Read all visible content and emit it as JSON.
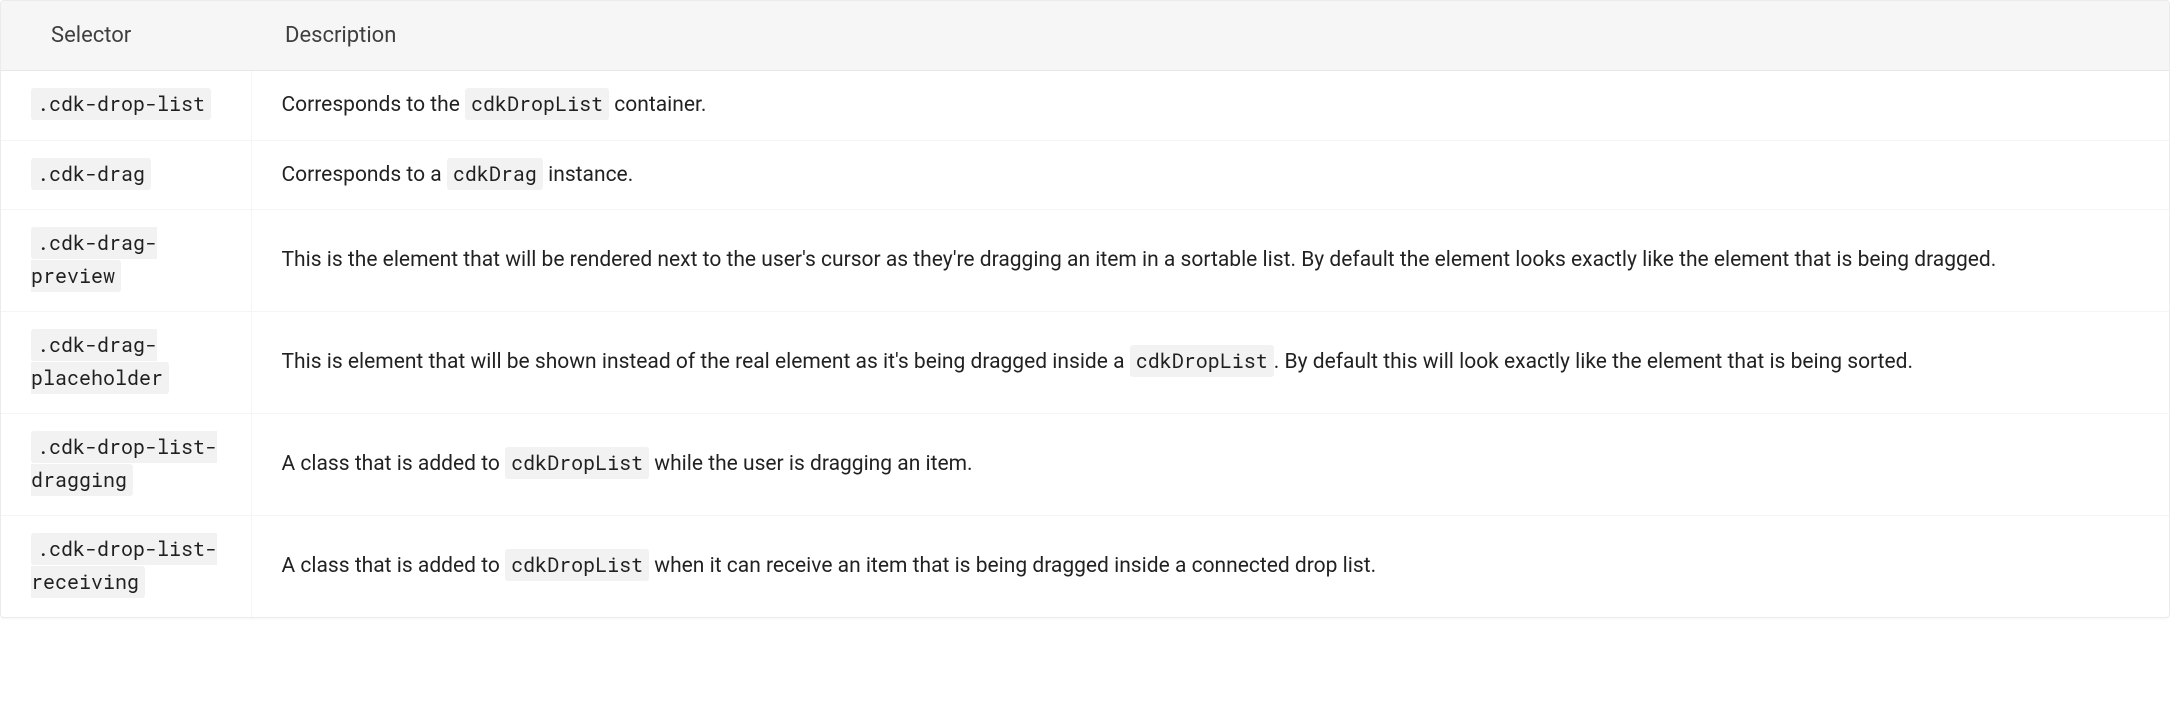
{
  "table": {
    "headers": {
      "selector": "Selector",
      "description": "Description"
    },
    "rows": [
      {
        "selector": ".cdk-drop-list",
        "desc_parts": [
          "Corresponds to the ",
          "cdkDropList",
          " container."
        ]
      },
      {
        "selector": ".cdk-drag",
        "desc_parts": [
          "Corresponds to a ",
          "cdkDrag",
          " instance."
        ]
      },
      {
        "selector": ".cdk-drag-preview",
        "desc_parts": [
          "This is the element that will be rendered next to the user's cursor as they're dragging an item in a sortable list. By default the element looks exactly like the element that is being dragged."
        ]
      },
      {
        "selector": ".cdk-drag-placeholder",
        "desc_parts": [
          "This is element that will be shown instead of the real element as it's being dragged inside a ",
          "cdkDropList",
          ". By default this will look exactly like the element that is being sorted."
        ]
      },
      {
        "selector": ".cdk-drop-list-dragging",
        "desc_parts": [
          "A class that is added to ",
          "cdkDropList",
          " while the user is dragging an item."
        ]
      },
      {
        "selector": ".cdk-drop-list-receiving",
        "desc_parts": [
          "A class that is added to ",
          "cdkDropList",
          " when it can receive an item that is being dragged inside a connected drop list."
        ]
      }
    ]
  }
}
